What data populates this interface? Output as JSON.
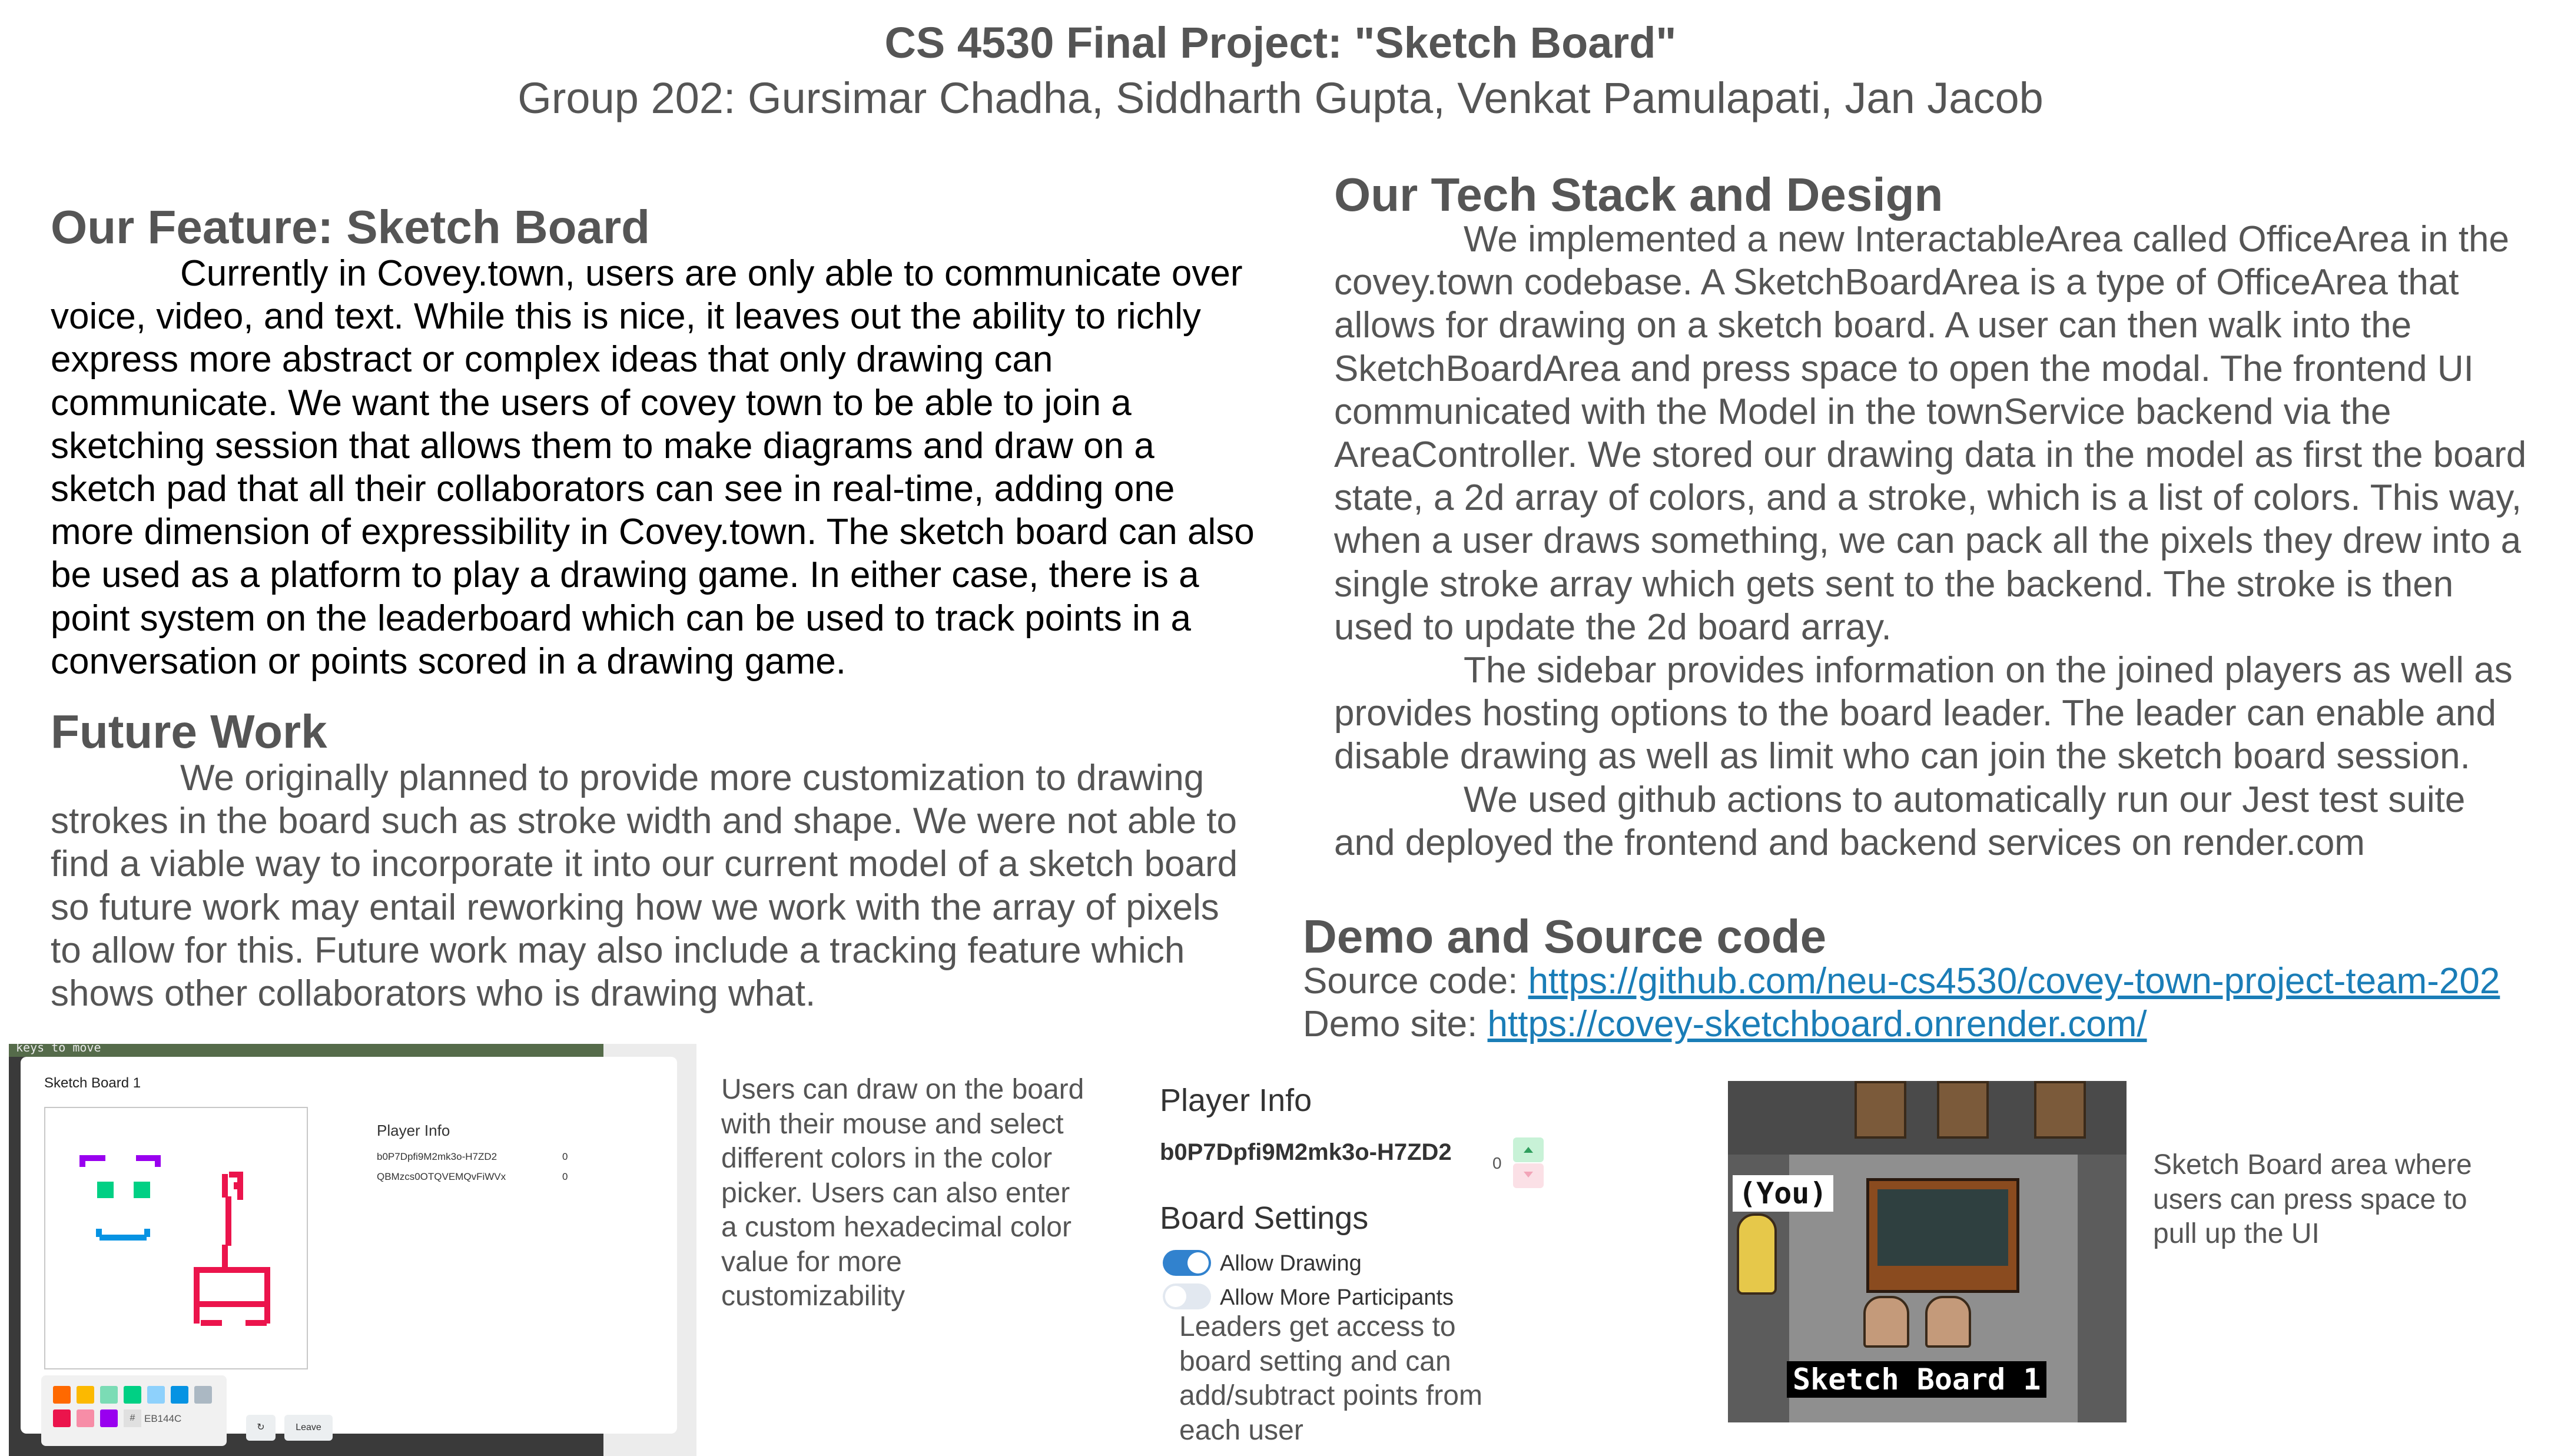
{
  "header": {
    "title": "CS 4530 Final Project: \"Sketch Board\"",
    "subtitle": "Group 202: Gursimar Chadha, Siddharth Gupta, Venkat Pamulapati, Jan Jacob"
  },
  "feature": {
    "heading": "Our Feature: Sketch Board",
    "body": "Currently in Covey.town, users are only able to communicate over voice, video, and text. While this is nice, it leaves out the ability to richly express more abstract or complex ideas that only drawing can communicate. We want the users of covey town to be able to join a sketching session that allows them to make diagrams and draw on a sketch pad that all their collaborators can see in real-time, adding one more dimension of expressibility in Covey.town. The sketch board can also be used as a platform to play a drawing game. In either case, there is a point system on the leaderboard which can be used to track points in a conversation or points scored in a drawing game."
  },
  "future": {
    "heading": "Future Work",
    "body": "We originally planned to provide more customization to drawing strokes in the board such as stroke width and shape. We were not able to find a viable way to incorporate it into our current model of a sketch board so future work may entail reworking how we work with the array of pixels to allow for this. Future work may also include a tracking feature which shows other collaborators who is drawing what."
  },
  "tech": {
    "heading": "Our Tech Stack and Design",
    "p1": "We implemented a new InteractableArea called OfficeArea in the covey.town codebase. A SketchBoardArea is a type of OfficeArea that allows for drawing on a sketch board. A user can then walk into the SketchBoardArea and press space to open the modal. The frontend UI communicated with the Model in the townService backend via the AreaController. We stored our drawing data in the model as first the board state, a 2d array of colors, and a stroke, which is a list of colors. This way, when a user draws something, we can pack all the pixels they drew into a single stroke array which gets sent to the backend. The stroke is then used to update the 2d board array.",
    "p2": "The sidebar provides information on the joined players as well as provides hosting options to the board leader. The leader can enable and disable drawing as well as limit who can join the sketch board session.",
    "p3": "We used github actions to automatically run our Jest test suite and deployed the frontend and backend services on render.com"
  },
  "demo": {
    "heading": "Demo and Source code",
    "source_label": "Source code: ",
    "source_url": "https://github.com/neu-cs4530/covey-town-project-team-202",
    "site_label": "Demo site: ",
    "site_url": "https://covey-sketchboard.onrender.com/"
  },
  "shot1": {
    "keys_text": "keys to move",
    "modal_title": "Sketch Board 1",
    "player_info_title": "Player Info",
    "players": [
      {
        "id": "b0P7Dpfi9M2mk3o-H7ZD2",
        "score": "0"
      },
      {
        "id": "QBMzcs0OTQVEMQvFiWVx",
        "score": "0"
      }
    ],
    "hex_prefix": "#",
    "hex_value": "EB144C",
    "refresh_icon": "refresh-icon",
    "leave_label": "Leave",
    "palette_colors": [
      "#ff6900",
      "#fcb900",
      "#7bdcb5",
      "#00d084",
      "#8ed1fc",
      "#0693e3",
      "#abb8c3",
      "#eb144c",
      "#f78da7",
      "#9900ef"
    ],
    "drawing_colors": {
      "eyebrows": "#9900ef",
      "eyes": "#00d084",
      "mouth": "#0693e3",
      "figure": "#eb144c"
    }
  },
  "caption1": "Users can draw on the board with their mouse and select different colors in the color picker. Users can also enter a custom hexadecimal color value for more customizability",
  "shot2": {
    "player_info_title": "Player Info",
    "player_id": "b0P7Dpfi9M2mk3o-H7ZD2",
    "player_score": "0",
    "board_settings_title": "Board Settings",
    "allow_drawing_label": "Allow Drawing",
    "allow_drawing_on": true,
    "allow_more_label": "Allow More Participants",
    "allow_more_on": false,
    "toggle_on_color": "#3182ce"
  },
  "caption2": "Leaders get access to board setting and can add/subtract points from each user",
  "shot3": {
    "you_label": "(You)",
    "board_label": "Sketch Board 1"
  },
  "caption3": "Sketch Board area where users can press space to pull up the UI"
}
